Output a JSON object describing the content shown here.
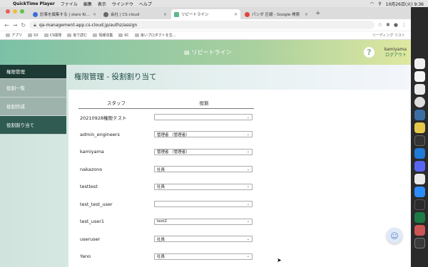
{
  "menubar": {
    "app": "QuickTime Player",
    "items": [
      "ファイル",
      "編集",
      "表示",
      "ウインドウ",
      "ヘルプ"
    ],
    "clock": "10月26日(火) 9:36"
  },
  "browser": {
    "tabs": [
      {
        "label": "記事を編集する | starx Kibela",
        "color": "#3b6fd6",
        "active": false
      },
      {
        "label": "会社 | CS cloud",
        "color": "#666",
        "active": false
      },
      {
        "label": "リピートライン",
        "color": "#5cb88a",
        "active": true
      },
      {
        "label": "パンダ 圧縮 - Google 検索",
        "color": "#e3453a",
        "active": false
      }
    ],
    "url": "qa-management-app.cs-cloud.jp/authz/assign",
    "bookmarks": [
      "アプリ",
      "SX",
      "CS開発",
      "後で読む",
      "情報収集",
      "KC",
      "良いプロダクトを生..."
    ],
    "reading_list": "リーディング リスト"
  },
  "header": {
    "logo": "リピートライン",
    "help": "?",
    "username": "kamiyama",
    "logout": "ログアウト"
  },
  "sidebar": {
    "heading": "権限管理",
    "items": [
      "役割一覧",
      "役割作成",
      "役割割り当て"
    ],
    "active_index": 2
  },
  "page_title": "権限管理 - 役割割り当て",
  "table": {
    "columns": [
      "スタッフ",
      "役割"
    ],
    "rows": [
      {
        "staff": "20210928権限テスト",
        "role": ""
      },
      {
        "staff": "admin_engineers",
        "role": "管理者 （管理者）"
      },
      {
        "staff": "kamiyama",
        "role": "管理者 （管理者）"
      },
      {
        "staff": "nakazono",
        "role": "社員"
      },
      {
        "staff": "testtest",
        "role": "社員"
      },
      {
        "staff": "test_test_user",
        "role": ""
      },
      {
        "staff": "test_user1",
        "role": "test2"
      },
      {
        "staff": "useruser",
        "role": "社員"
      },
      {
        "staff": "Yano",
        "role": "社員"
      }
    ]
  },
  "colors": {
    "sidebar_head": "#1d3a34",
    "sidebar_active": "#2f5b52",
    "sidebar_item": "#9fb3ad",
    "header_start": "#7cc1a7",
    "header_end": "#dfe8a0",
    "title": "#1f4a43"
  }
}
